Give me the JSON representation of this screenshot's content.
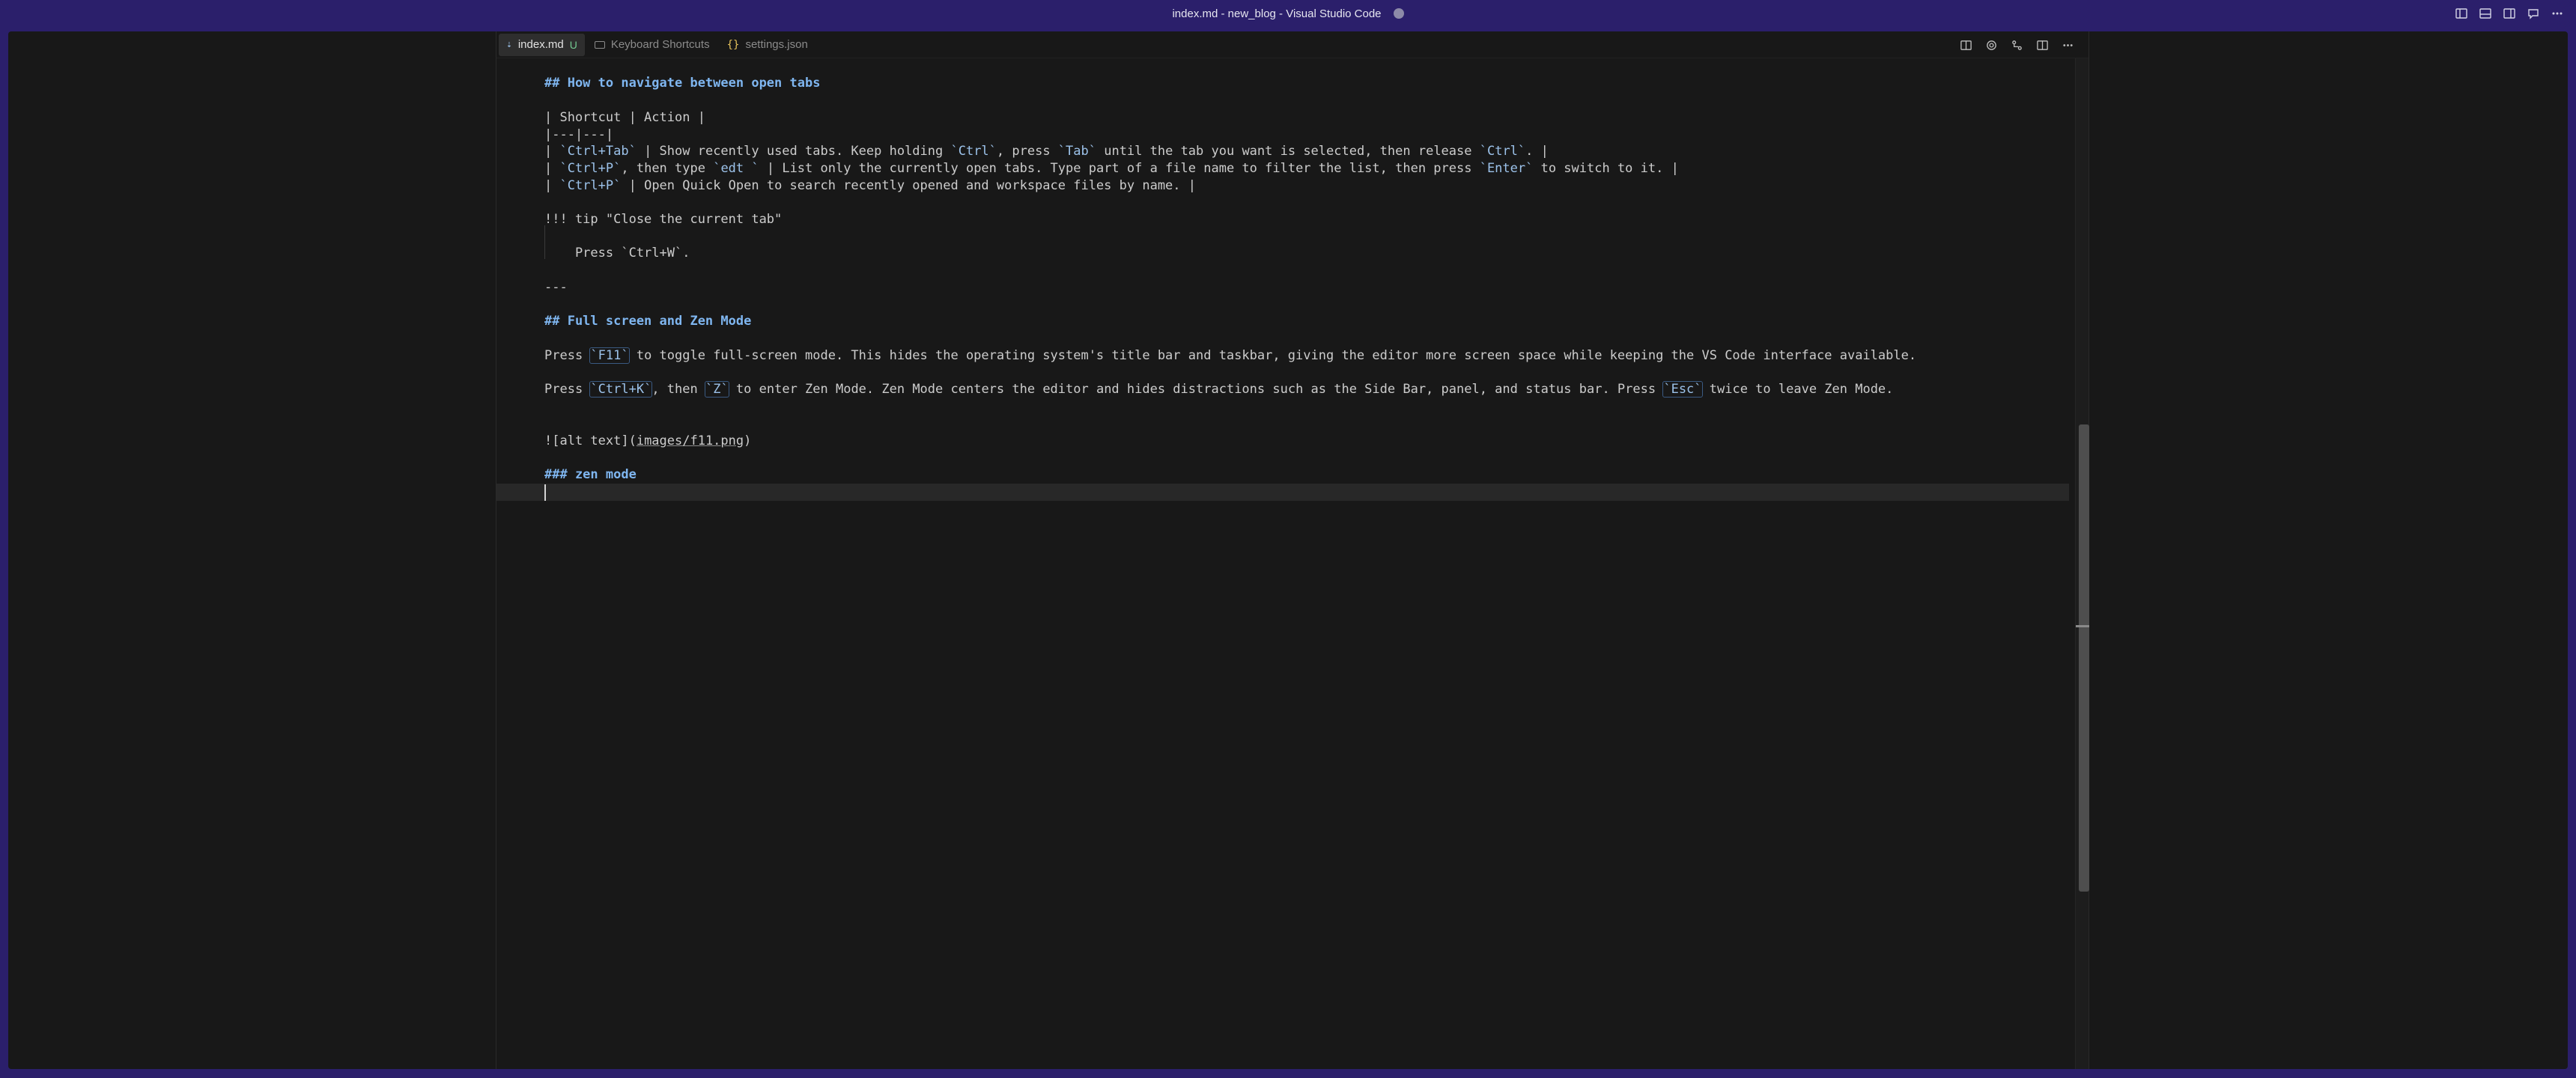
{
  "window": {
    "title": "index.md - new_blog - Visual Studio Code"
  },
  "tabs": [
    {
      "label": "index.md",
      "status": "U",
      "icon": "markdown-icon",
      "active": true
    },
    {
      "label": "Keyboard Shortcuts",
      "icon": "keyboard-icon",
      "active": false
    },
    {
      "label": "settings.json",
      "icon": "json-icon",
      "active": false
    }
  ],
  "editor": {
    "lines": {
      "h_tabs": "## How to navigate between open tabs",
      "table_header": "| Shortcut | Action |",
      "table_sep": "|---|---|",
      "row1_pre": "| ",
      "row1_code1": "`Ctrl+Tab`",
      "row1_mid1": " | Show recently used tabs. Keep holding ",
      "row1_code2": "`Ctrl`",
      "row1_mid2": ", press ",
      "row1_code3": "`Tab`",
      "row1_mid3": " until the tab you want is selected, then release ",
      "row1_code4": "`Ctrl`",
      "row1_end": ". |",
      "row2_pre": "| ",
      "row2_code1": "`Ctrl+P`",
      "row2_mid1": ", then type ",
      "row2_code2": "`edt `",
      "row2_mid2": " | List only the currently open tabs. Type part of a file name to filter the list, then press ",
      "row2_code3": "`Enter`",
      "row2_end": " to switch to it. |",
      "row3_pre": "| ",
      "row3_code1": "`Ctrl+P`",
      "row3_end": " | Open Quick Open to search recently opened and workspace files by name. |",
      "tip": "!!! tip \"Close the current tab\"",
      "tip_body": "    Press `Ctrl+W`.",
      "hr": "---",
      "h_fullscreen": "## Full screen and Zen Mode",
      "p1_pre": "Press ",
      "p1_code": "`F11`",
      "p1_end": " to toggle full-screen mode. This hides the operating system's title bar and taskbar, giving the editor more screen space while keeping the VS Code interface available.",
      "p2_pre": "Press ",
      "p2_code1": "`Ctrl+K`",
      "p2_mid1": ", then ",
      "p2_code2": "`Z`",
      "p2_mid2": " to enter Zen Mode. Zen Mode centers the editor and hides distractions such as the Side Bar, panel, and status bar. Press ",
      "p2_code3": "`Esc`",
      "p2_end": " twice to leave Zen Mode.",
      "img_alt": "![alt text](",
      "img_src": "images/f11.png",
      "img_end": ")",
      "h_zen": "### zen mode"
    }
  }
}
